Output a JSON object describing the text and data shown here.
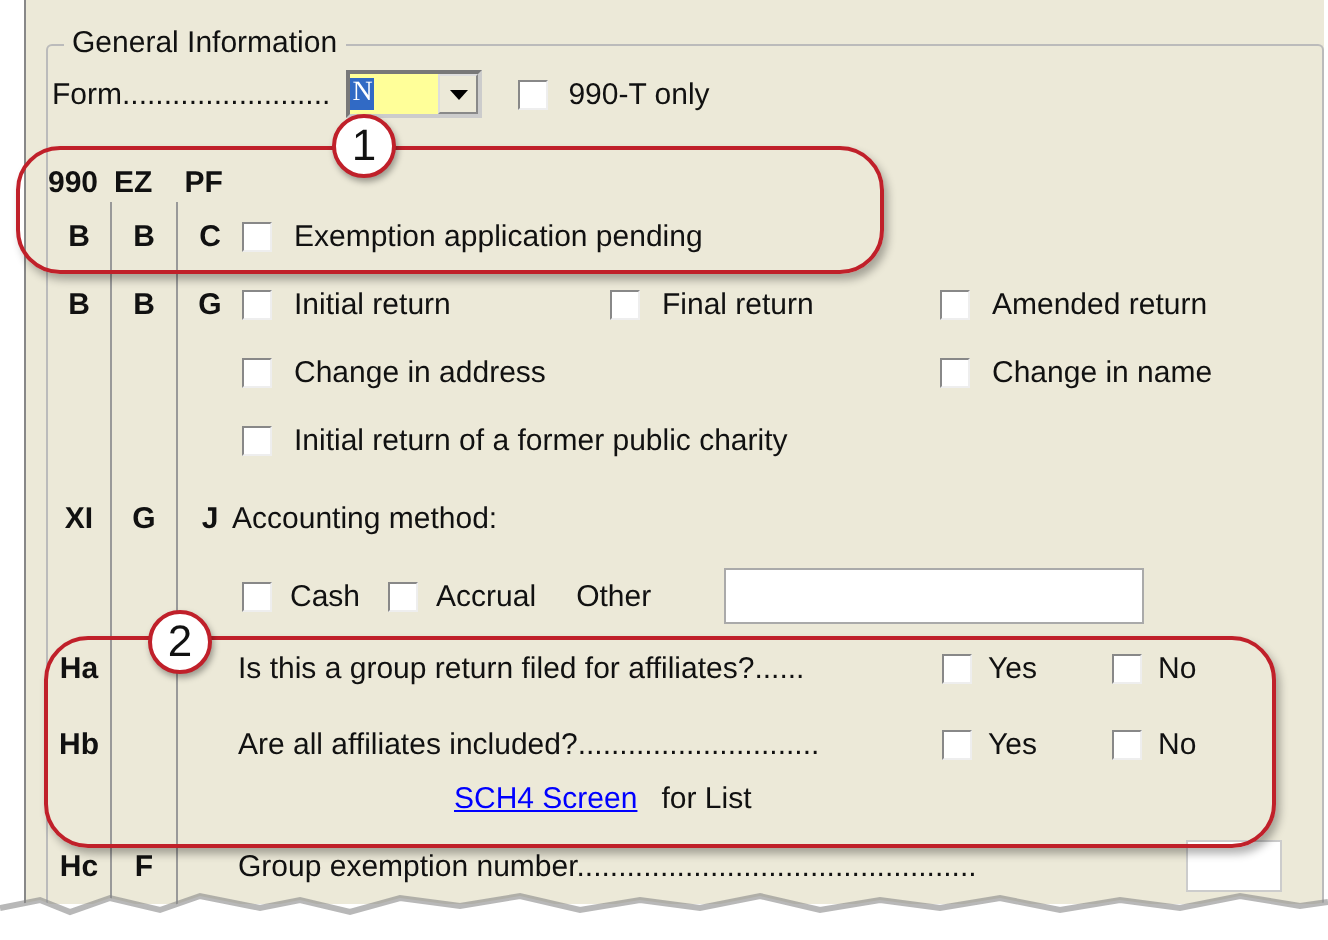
{
  "section": {
    "title": "General Information"
  },
  "form_row": {
    "label": "Form.........................",
    "value": "N",
    "checkbox": {
      "label": "990-T only",
      "checked": false
    }
  },
  "column_headers": [
    "990",
    "EZ",
    "PF"
  ],
  "rows": [
    {
      "kind": "checks",
      "codes": [
        "B",
        "B",
        "C"
      ],
      "left": {
        "label": "Exemption application pending",
        "checked": false
      }
    },
    {
      "kind": "checks",
      "codes": [
        "B",
        "B",
        "G"
      ],
      "left": {
        "label": "Initial return",
        "checked": false
      },
      "middle": {
        "label": "Final return",
        "checked": false
      },
      "right": {
        "label": "Amended return",
        "checked": false
      }
    },
    {
      "kind": "checks",
      "codes": [],
      "left": {
        "label": "Change in address",
        "checked": false
      },
      "right": {
        "label": "Change in name",
        "checked": false
      }
    },
    {
      "kind": "checks",
      "codes": [],
      "left": {
        "label": "Initial return of a former public charity",
        "checked": false
      }
    },
    {
      "kind": "heading",
      "codes": [
        "XI",
        "G",
        "J"
      ],
      "text": "Accounting method:"
    },
    {
      "kind": "method",
      "codes": [],
      "items": [
        {
          "label": "Cash",
          "checked": false
        },
        {
          "label": "Accrual",
          "checked": false
        }
      ],
      "other_label": "Other"
    },
    {
      "kind": "question",
      "codes": [
        "Ha"
      ],
      "text": "Is this a group return filed for affiliates?......",
      "items": [
        {
          "label": "Yes",
          "checked": false
        },
        {
          "label": "No",
          "checked": false
        }
      ]
    },
    {
      "kind": "question",
      "codes": [
        "Hb"
      ],
      "text": "Are all affiliates included?.............................",
      "items": [
        {
          "label": "Yes",
          "checked": false
        },
        {
          "label": "No",
          "checked": false
        }
      ]
    },
    {
      "kind": "link",
      "codes": [],
      "link": "SCH4 Screen",
      "text": "for List"
    },
    {
      "kind": "field",
      "codes": [
        "Hc",
        "F"
      ],
      "text": "Group exemption number................................................"
    }
  ],
  "callouts": [
    {
      "number": "1"
    },
    {
      "number": "2"
    }
  ]
}
